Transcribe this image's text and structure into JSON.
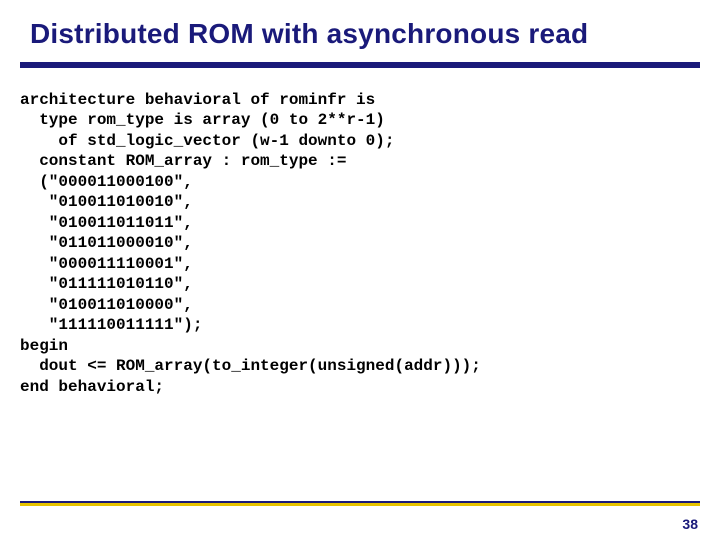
{
  "title": "Distributed ROM with asynchronous read",
  "code": {
    "l0": "architecture behavioral of rominfr is",
    "l1": "  type rom_type is array (0 to 2**r-1)",
    "l2": "    of std_logic_vector (w-1 downto 0);",
    "l3": "  constant ROM_array : rom_type :=",
    "l4": "  (\"000011000100\",",
    "l5": "   \"010011010010\",",
    "l6": "   \"010011011011\",",
    "l7": "   \"011011000010\",",
    "l8": "   \"000011110001\",",
    "l9": "   \"011111010110\",",
    "l10": "   \"010011010000\",",
    "l11": "   \"111110011111\");",
    "l12": "begin",
    "l13": "  dout <= ROM_array(to_integer(unsigned(addr)));",
    "l14": "end behavioral;"
  },
  "page_number": "38"
}
